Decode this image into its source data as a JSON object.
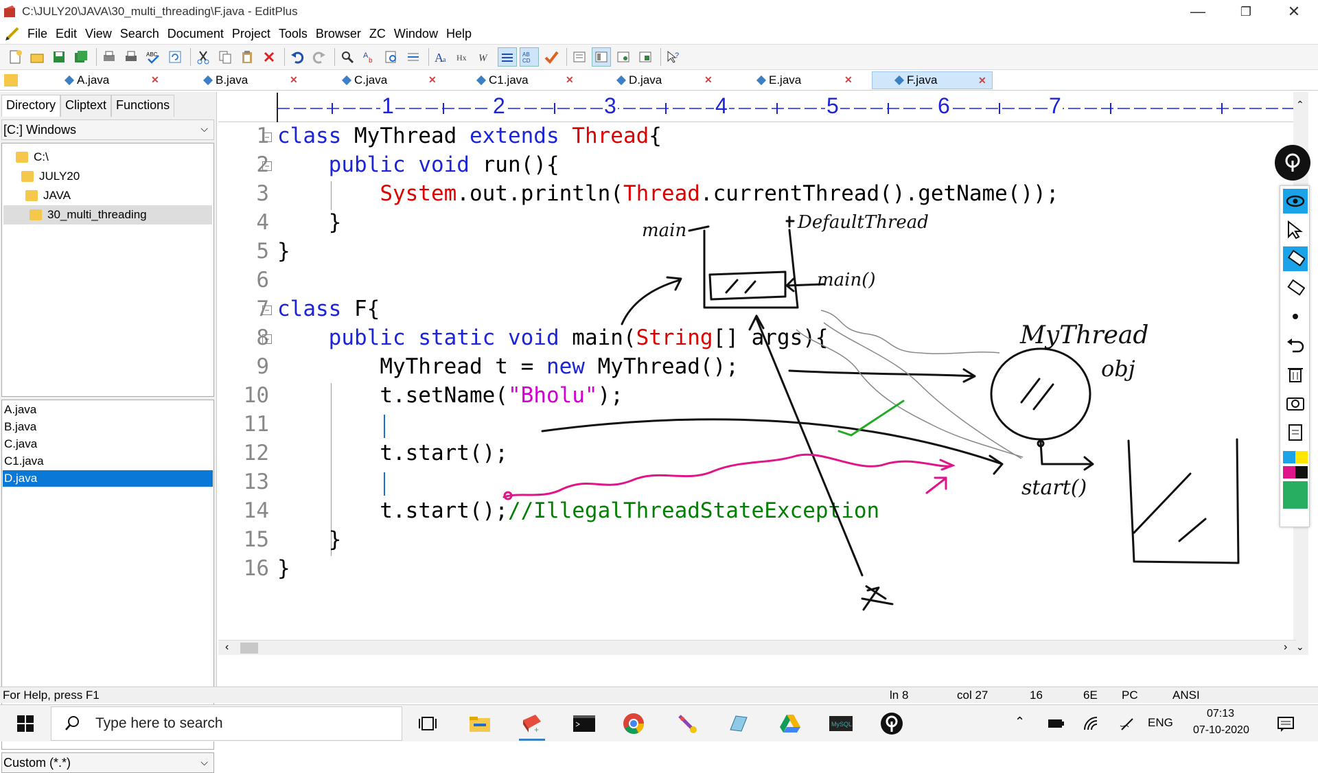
{
  "window": {
    "title": "C:\\JULY20\\JAVA\\30_multi_threading\\F.java - EditPlus",
    "minimize": "—",
    "restore": "❐",
    "close": "✕"
  },
  "menu": [
    "File",
    "Edit",
    "View",
    "Search",
    "Document",
    "Project",
    "Tools",
    "Browser",
    "ZC",
    "Window",
    "Help"
  ],
  "tabs": [
    {
      "label": "A.java"
    },
    {
      "label": "B.java"
    },
    {
      "label": "C.java"
    },
    {
      "label": "C1.java"
    },
    {
      "label": "D.java"
    },
    {
      "label": "E.java"
    },
    {
      "label": "F.java",
      "active": true
    }
  ],
  "left_panel": {
    "tabs": [
      "Directory",
      "Cliptext",
      "Functions"
    ],
    "drive": "[C:] Windows",
    "tree": [
      "C:\\",
      "JULY20",
      "JAVA",
      "30_multi_threading"
    ],
    "files": [
      "A.java",
      "B.java",
      "C.java",
      "C1.java",
      "D.java"
    ],
    "selected_file": "D.java",
    "filter": "Custom (*.*)"
  },
  "ruler": [
    "1",
    "2",
    "3",
    "4",
    "5",
    "6",
    "7"
  ],
  "code": {
    "line_numbers": [
      "1",
      "2",
      "3",
      "4",
      "5",
      "6",
      "7",
      "8",
      "9",
      "10",
      "11",
      "12",
      "13",
      "14",
      "15",
      "16"
    ],
    "l1": {
      "kw1": "class",
      "t1": " MyThread ",
      "kw2": "extends",
      "t2": " ",
      "cls": "Thread",
      "t3": "{"
    },
    "l2": {
      "ind": "    ",
      "kw1": "public",
      "t1": " ",
      "kw2": "void",
      "t2": " run(){"
    },
    "l3": {
      "ind": "        ",
      "cls1": "System",
      "t1": ".out.println(",
      "cls2": "Thread",
      "t2": ".currentThread().getName());"
    },
    "l4": {
      "t": "    }"
    },
    "l5": {
      "t": "}"
    },
    "l7": {
      "kw1": "class",
      "t1": " F{"
    },
    "l8": {
      "ind": "    ",
      "kw1": "public",
      "t1": " ",
      "kw2": "static",
      "t2": " ",
      "kw3": "void",
      "t3": " main(",
      "cls": "String",
      "t4": "[] args){"
    },
    "l9": {
      "ind": "        ",
      "t1": "MyThread t = ",
      "kw1": "new",
      "t2": " MyThread();"
    },
    "l10": {
      "ind": "        ",
      "t1": "t.setName(",
      "str": "\"Bholu\"",
      "t2": ");"
    },
    "l12": {
      "t": "        t.start();"
    },
    "l14": {
      "t1": "        t.start();",
      "cm": "//IllegalThreadStateException"
    },
    "l15": {
      "t": "    }"
    },
    "l16": {
      "t": "}"
    }
  },
  "ink_labels": {
    "main_label": "main",
    "default_thread": "DefaultThread",
    "main_method": "main()",
    "mythread_obj_1": "MyThread",
    "mythread_obj_2": "obj",
    "start_label": "start()"
  },
  "status": {
    "help": "For Help, press F1",
    "ln": "ln 8",
    "col": "col 27",
    "n16": "16",
    "hex": "6E",
    "pc": "PC",
    "enc": "ANSI"
  },
  "taskbar": {
    "search_placeholder": "Type here to search",
    "lang": "ENG",
    "time": "07:13",
    "date": "07-10-2020"
  },
  "colors": {
    "keyword": "#1c24d8",
    "class": "#dd0000",
    "string": "#d000d0",
    "comment": "#008000",
    "selection": "#0a78d7",
    "ink_black": "#111111",
    "ink_green": "#22aa22",
    "ink_pink": "#e0158a"
  }
}
